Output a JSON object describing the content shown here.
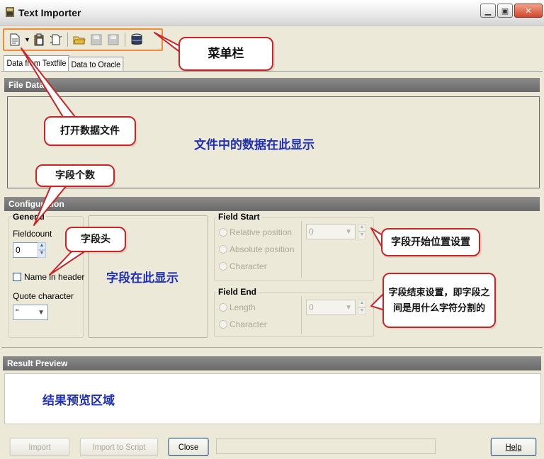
{
  "window": {
    "title": "Text Importer"
  },
  "tabs": [
    {
      "label": "Data from Textfile",
      "active": true
    },
    {
      "label": "Data to Oracle",
      "active": false
    }
  ],
  "sections": {
    "file_data": "File Data",
    "configuration": "Configuration",
    "result_preview": "Result Preview"
  },
  "general": {
    "title": "General",
    "fieldcount_label": "Fieldcount",
    "fieldcount_value": "0",
    "name_in_header": "Name in header",
    "quote_label": "Quote character",
    "quote_value": "\""
  },
  "field_start": {
    "title": "Field Start",
    "options": [
      "Relative position",
      "Absolute position",
      "Character"
    ],
    "value": "0"
  },
  "field_end": {
    "title": "Field End",
    "options": [
      "Length",
      "Character"
    ],
    "value": "0"
  },
  "buttons": {
    "import": "Import",
    "import_to_script": "Import to Script",
    "close": "Close",
    "help": "Help"
  },
  "annotations": {
    "menu_bar": "菜单栏",
    "open_file": "打开数据文件",
    "file_data_note": "文件中的数据在此显示",
    "field_count": "字段个数",
    "field_header": "字段头",
    "field_display": "字段在此显示",
    "field_start_setting": "字段开始位置设置",
    "field_end_line1": "字段结束设置，即字段之",
    "field_end_line2": "间是用什么字符分割的",
    "result_area": "结果预览区域"
  },
  "colors": {
    "annotation_border": "#cc2323",
    "toolbar_highlight": "#f08a3c",
    "note_text": "#1f2fb6"
  },
  "icons": [
    "app-icon",
    "open-file-icon",
    "dropdown-arrow-icon",
    "paste-icon",
    "new-icon",
    "folder-open-icon",
    "save-icon",
    "save-all-icon",
    "database-icon"
  ]
}
